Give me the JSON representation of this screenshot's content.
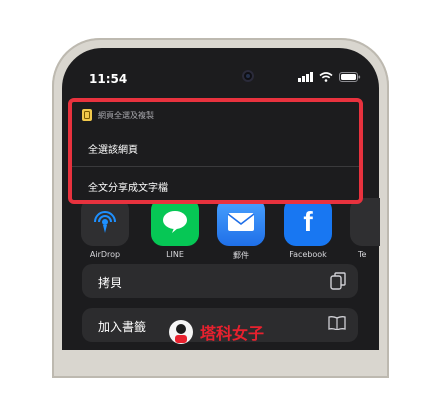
{
  "status_bar": {
    "time": "11:54"
  },
  "apps": [
    {
      "label": "AirDrop",
      "color": "#2f2f31"
    },
    {
      "label": "LINE",
      "color": "#06c755"
    },
    {
      "label": "郵件",
      "color": "#2f7ef6"
    },
    {
      "label": "Facebook",
      "color": "#1877f2"
    },
    {
      "label": "Te",
      "color": "#2f2f31"
    }
  ],
  "actions": [
    {
      "label": "拷貝",
      "icon": "copy-icon"
    },
    {
      "label": "加入書籤",
      "icon": "book-icon"
    }
  ],
  "shortcut_menu": {
    "title": "網頁全選及複製",
    "items": [
      {
        "label": "全選該網頁"
      },
      {
        "label": "全文分享成文字檔"
      }
    ],
    "highlight_color": "#e8323e"
  },
  "watermark": {
    "text": "塔科女子"
  }
}
